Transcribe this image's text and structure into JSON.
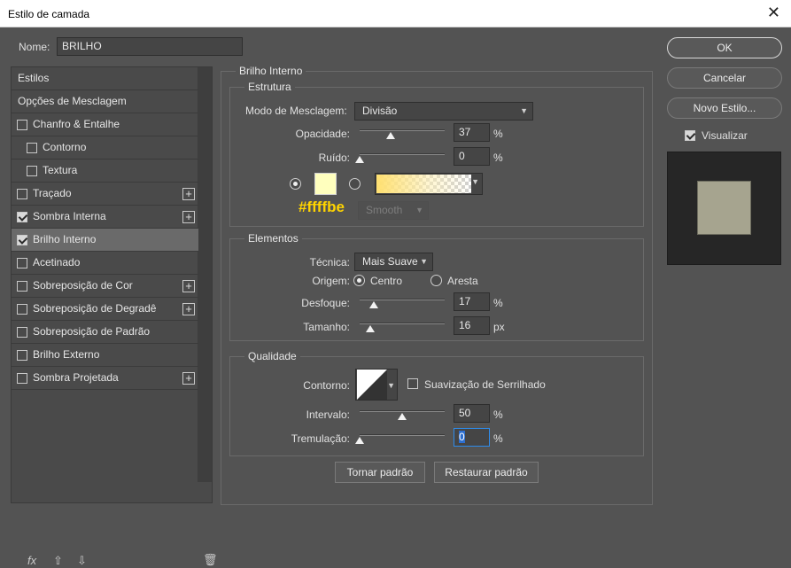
{
  "window": {
    "title": "Estilo de camada",
    "close": "✕"
  },
  "name_label": "Nome:",
  "name_value": "BRILHO",
  "styles": {
    "header": "Estilos",
    "blending": "Opções de Mesclagem",
    "items": [
      {
        "label": "Chanfro & Entalhe",
        "checked": false,
        "plus": false
      },
      {
        "label": "Contorno",
        "checked": false,
        "plus": false
      },
      {
        "label": "Textura",
        "checked": false,
        "plus": false
      },
      {
        "label": "Traçado",
        "checked": false,
        "plus": true
      },
      {
        "label": "Sombra Interna",
        "checked": true,
        "plus": true
      },
      {
        "label": "Brilho Interno",
        "checked": true,
        "plus": false,
        "selected": true
      },
      {
        "label": "Acetinado",
        "checked": false,
        "plus": false
      },
      {
        "label": "Sobreposição de Cor",
        "checked": false,
        "plus": true
      },
      {
        "label": "Sobreposição de Degradê",
        "checked": false,
        "plus": true
      },
      {
        "label": "Sobreposição de Padrão",
        "checked": false,
        "plus": false
      },
      {
        "label": "Brilho Externo",
        "checked": false,
        "plus": false
      },
      {
        "label": "Sombra Projetada",
        "checked": false,
        "plus": true
      }
    ],
    "fx_icon": "fx",
    "up_icon": "⇧",
    "down_icon": "⇩",
    "trash_icon": "🗑"
  },
  "inner_glow": {
    "title": "Brilho Interno",
    "structure": {
      "title": "Estrutura",
      "blend_mode_label": "Modo de Mesclagem:",
      "blend_mode_value": "Divisão",
      "opacity_label": "Opacidade:",
      "opacity_value": "37",
      "opacity_unit": "%",
      "noise_label": "Ruído:",
      "noise_value": "0",
      "noise_unit": "%",
      "color_hex": "#ffffbe",
      "smooth_label": "Smooth"
    },
    "elements": {
      "title": "Elementos",
      "technique_label": "Técnica:",
      "technique_value": "Mais Suave",
      "source_label": "Origem:",
      "source_center": "Centro",
      "source_edge": "Aresta",
      "choke_label": "Desfoque:",
      "choke_value": "17",
      "choke_unit": "%",
      "size_label": "Tamanho:",
      "size_value": "16",
      "size_unit": "px"
    },
    "quality": {
      "title": "Qualidade",
      "contour_label": "Contorno:",
      "antialias_label": "Suavização de Serrilhado",
      "range_label": "Intervalo:",
      "range_value": "50",
      "range_unit": "%",
      "jitter_label": "Tremulação:",
      "jitter_value": "0",
      "jitter_unit": "%"
    },
    "make_default": "Tornar padrão",
    "reset_default": "Restaurar padrão"
  },
  "buttons": {
    "ok": "OK",
    "cancel": "Cancelar",
    "new_style": "Novo Estilo...",
    "preview_label": "Visualizar"
  }
}
